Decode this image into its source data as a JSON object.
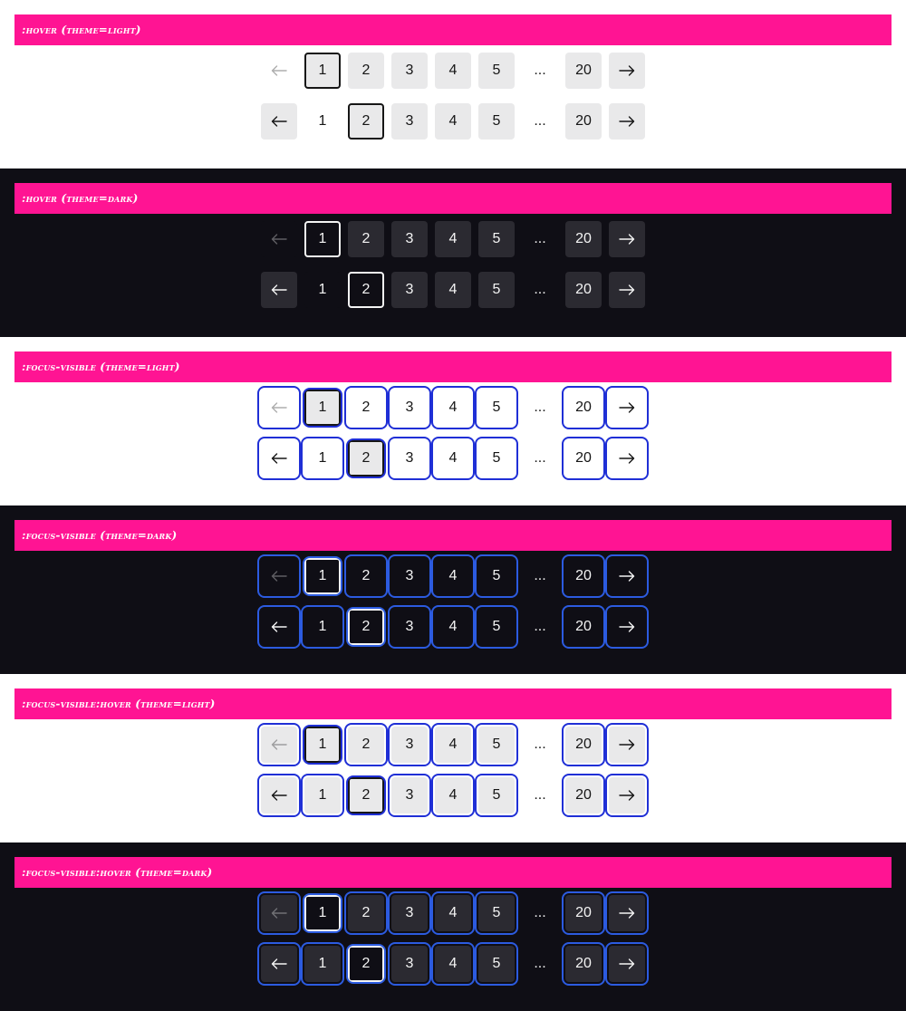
{
  "sections": [
    {
      "title": ":hover (theme=light)"
    },
    {
      "title": ":hover (theme=dark)"
    },
    {
      "title": ":focus-visible (theme=light)"
    },
    {
      "title": ":focus-visible (theme=dark)"
    },
    {
      "title": ":focus-visible:hover (theme=light)"
    },
    {
      "title": ":focus-visible:hover (theme=dark)"
    }
  ],
  "pager": {
    "pages": [
      "1",
      "2",
      "3",
      "4",
      "5"
    ],
    "ellipsis": "...",
    "last_page": "20",
    "prev_icon": "arrow-left-icon",
    "next_icon": "arrow-right-icon"
  },
  "colors": {
    "banner": "#ff1493",
    "focus_ring_light": "#1f2fd6",
    "focus_ring_dark": "#2c5be0",
    "dark_bg": "#0f0e15"
  }
}
